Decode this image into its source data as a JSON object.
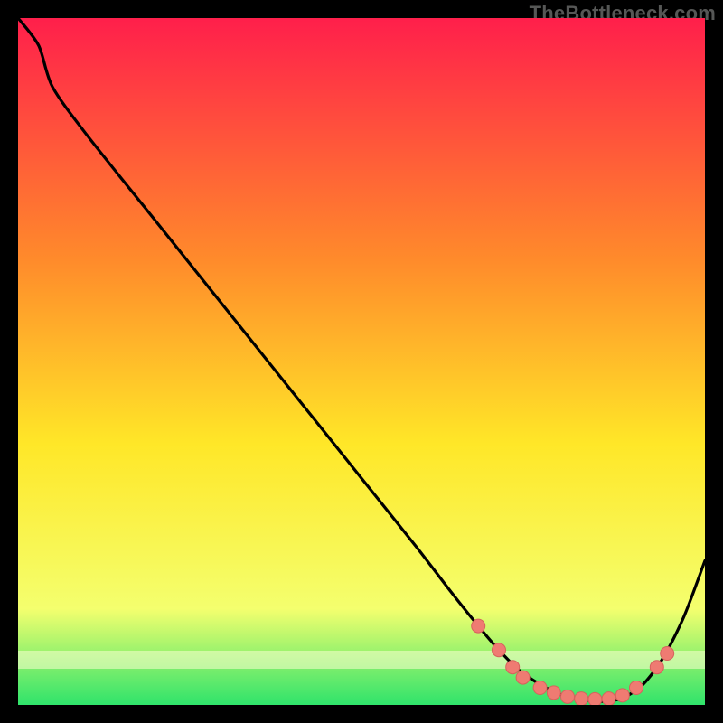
{
  "watermark": "TheBottleneck.com",
  "colors": {
    "gradient_top": "#ff1f4b",
    "gradient_mid_upper": "#ff8a2b",
    "gradient_mid": "#ffe728",
    "gradient_lower": "#f4ff6e",
    "gradient_bottom": "#2fe36b",
    "curve": "#000000",
    "marker_fill": "#ef7b72",
    "marker_stroke": "#d6625c"
  },
  "chart_data": {
    "type": "line",
    "title": "",
    "xlabel": "",
    "ylabel": "",
    "xlim": [
      0,
      100
    ],
    "ylim": [
      0,
      100
    ],
    "grid": false,
    "legend": false,
    "series": [
      {
        "name": "bottleneck-curve",
        "x": [
          0,
          3,
          5,
          10,
          20,
          30,
          40,
          50,
          58,
          63,
          67,
          70,
          73,
          76,
          79,
          82,
          85,
          88,
          91,
          94,
          97,
          100
        ],
        "y": [
          100,
          96,
          90,
          83,
          70.5,
          58,
          45.5,
          33,
          23,
          16.5,
          11.5,
          8,
          5,
          3,
          1.5,
          0.8,
          0.5,
          1,
          3,
          7,
          13,
          21
        ]
      }
    ],
    "markers": {
      "series": "bottleneck-curve",
      "points": [
        {
          "x": 67,
          "y": 11.5
        },
        {
          "x": 70,
          "y": 8
        },
        {
          "x": 72,
          "y": 5.5
        },
        {
          "x": 73.5,
          "y": 4
        },
        {
          "x": 76,
          "y": 2.5
        },
        {
          "x": 78,
          "y": 1.8
        },
        {
          "x": 80,
          "y": 1.2
        },
        {
          "x": 82,
          "y": 0.9
        },
        {
          "x": 84,
          "y": 0.8
        },
        {
          "x": 86,
          "y": 0.9
        },
        {
          "x": 88,
          "y": 1.4
        },
        {
          "x": 90,
          "y": 2.5
        },
        {
          "x": 93,
          "y": 5.5
        },
        {
          "x": 94.5,
          "y": 7.5
        }
      ]
    }
  }
}
